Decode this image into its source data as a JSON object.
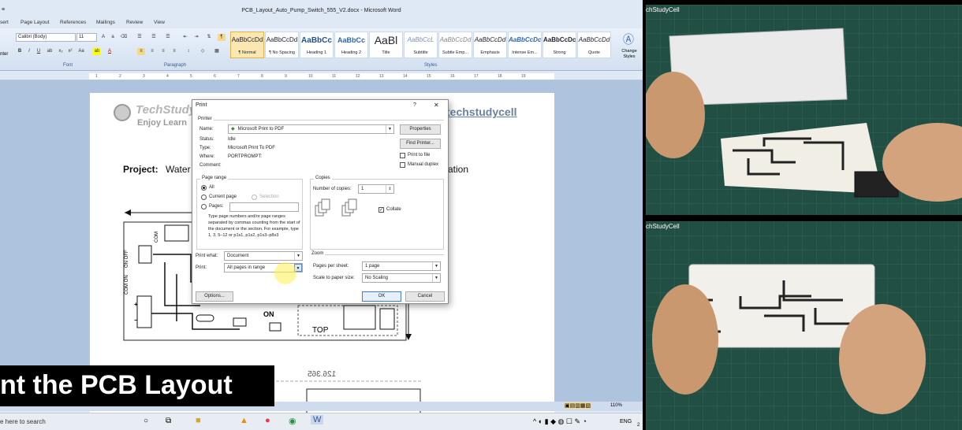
{
  "window": {
    "title": "PCB_Layout_Auto_Pump_Switch_555_V2.docx - Microsoft Word",
    "quick_access": "≡"
  },
  "tabs": [
    "sert",
    "Page Layout",
    "References",
    "Mailings",
    "Review",
    "View"
  ],
  "ribbon": {
    "font_name": "Calibri (Body)",
    "font_size": "11",
    "paste_fragment": "nter",
    "groups": {
      "font": "Font",
      "paragraph": "Paragraph",
      "styles": "Styles"
    },
    "styles": [
      {
        "preview": "AaBbCcDd",
        "name": "¶ Normal"
      },
      {
        "preview": "AaBbCcDd",
        "name": "¶ No Spacing"
      },
      {
        "preview": "AaBbCc",
        "name": "Heading 1"
      },
      {
        "preview": "AaBbCc",
        "name": "Heading 2"
      },
      {
        "preview": "AaBl",
        "name": "Title"
      },
      {
        "preview": "AaBbCcL",
        "name": "Subtitle"
      },
      {
        "preview": "AaBbCcDd",
        "name": "Subtle Emp..."
      },
      {
        "preview": "AaBbCcDd",
        "name": "Emphasis"
      },
      {
        "preview": "AaBbCcDc",
        "name": "Intense Em..."
      },
      {
        "preview": "AaBbCcDc",
        "name": "Strong"
      },
      {
        "preview": "AaBbCcDd",
        "name": "Quote"
      }
    ],
    "change_styles": "Change Styles"
  },
  "ruler_numbers": [
    "1",
    "2",
    "3",
    "4",
    "5",
    "6",
    "7",
    "8",
    "9",
    "10",
    "11",
    "12",
    "13",
    "14",
    "15",
    "16",
    "17",
    "18",
    "19"
  ],
  "document": {
    "logo_title": "TechStudy",
    "logo_sub": "Enjoy Learn",
    "site": "techstudycell",
    "project_label": "Project:",
    "project_start": "Water",
    "project_end": "ation",
    "pcb_labels": {
      "com": "COM",
      "on_off": "ON OFF",
      "com_on": "COM ON",
      "on": "ON",
      "top": "TOP",
      "plus": "+",
      "minus": "−",
      "dim": "126.365"
    }
  },
  "print_dialog": {
    "title": "Print",
    "help": "?",
    "close": "✕",
    "printer_section": "Printer",
    "name_label": "Name:",
    "printer_name": "Microsoft Print to PDF",
    "status_label": "Status:",
    "status_value": "Idle",
    "type_label": "Type:",
    "type_value": "Microsoft Print To PDF",
    "where_label": "Where:",
    "where_value": "PORTPROMPT:",
    "comment_label": "Comment:",
    "properties": "Properties",
    "find_printer": "Find Printer...",
    "print_to_file": "Print to file",
    "manual_duplex": "Manual duplex",
    "page_range": "Page range",
    "all": "All",
    "current_page": "Current page",
    "selection": "Selection",
    "pages": "Pages:",
    "pages_hint": "Type page numbers and/or page ranges separated by commas counting from the start of the document or the section. For example, type 1, 3, 5–12 or p1s1, p1s2, p1s3–p8s3",
    "copies": "Copies",
    "number_of_copies": "Number of copies:",
    "copies_value": "1",
    "collate": "Collate",
    "print_what_label": "Print what:",
    "print_what_value": "Document",
    "print_label": "Print:",
    "print_value": "All pages in range",
    "zoom": "Zoom",
    "pages_per_sheet_label": "Pages per sheet:",
    "pages_per_sheet_value": "1 page",
    "scale_label": "Scale to paper size:",
    "scale_value": "No Scaling",
    "options": "Options...",
    "ok": "OK",
    "cancel": "Cancel"
  },
  "overlay_text": "nt the PCB Layout",
  "taskbar": {
    "search": "e here to search",
    "lang": "ENG",
    "zoom": "110%",
    "sys_digit": "2"
  },
  "photos": {
    "watermark": "chStudyCell",
    "watermark2": "chStudyCell"
  },
  "colors": {
    "accent": "#3c6fb0",
    "overlay_bg": "#000000",
    "mat": "#214f44"
  }
}
